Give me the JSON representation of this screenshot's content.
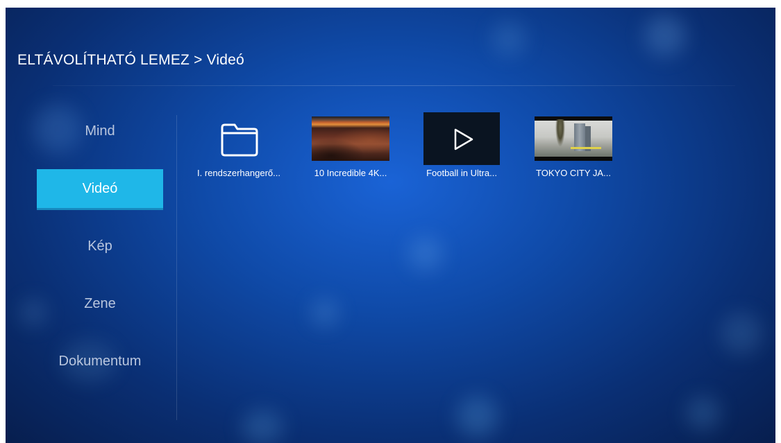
{
  "breadcrumb": "ELTÁVOLÍTHATÓ LEMEZ > Videó",
  "sidebar": {
    "items": [
      {
        "label": "Mind",
        "active": false
      },
      {
        "label": "Videó",
        "active": true
      },
      {
        "label": "Kép",
        "active": false
      },
      {
        "label": "Zene",
        "active": false
      },
      {
        "label": "Dokumentum",
        "active": false
      }
    ]
  },
  "files": [
    {
      "label": "I. rendszerhangerő...",
      "type": "folder",
      "icon": "folder-icon"
    },
    {
      "label": "10 Incredible 4K...",
      "type": "video"
    },
    {
      "label": "Football in Ultra...",
      "type": "video",
      "icon": "play-icon"
    },
    {
      "label": "TOKYO CITY JA...",
      "type": "video"
    }
  ],
  "colors": {
    "accent": "#1fb7e8",
    "background": "#0f4aa8"
  }
}
